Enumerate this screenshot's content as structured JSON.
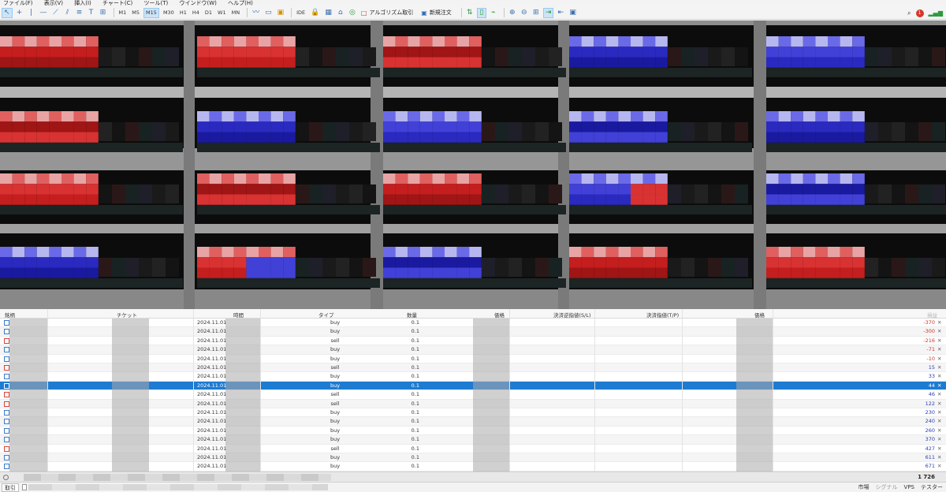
{
  "menu": {
    "items": [
      "ファイル(F)",
      "表示(V)",
      "挿入(I)",
      "チャート(C)",
      "ツール(T)",
      "ウインドウ(W)",
      "ヘルプ(H)"
    ]
  },
  "toolbar": {
    "tools": [
      "cursor-icon",
      "crosshair-icon",
      "vertical-line-icon",
      "horizontal-line-icon",
      "trendline-icon",
      "channel-icon",
      "fibonacci-icon",
      "text-icon",
      "shapes-icon"
    ],
    "timeframes": [
      "M1",
      "M5",
      "M15",
      "M30",
      "H1",
      "H4",
      "D1",
      "W1",
      "MN"
    ],
    "active_timeframe": "M15",
    "ide_label": "IDE",
    "algo_label": "アルゴリズム取引",
    "new_order_label": "新規注文",
    "notification_count": "1"
  },
  "table": {
    "headers": {
      "symbol": "銘柄",
      "ticket": "チケット",
      "time": "時間",
      "type": "タイプ",
      "volume": "数量",
      "price": "価格",
      "sl": "決済逆指値(S/L)",
      "tp": "決済指値(T/P)",
      "price2": "価格",
      "profit": "損益"
    },
    "rows": [
      {
        "time": "2024.11.01",
        "type": "buy",
        "volume": "0.1",
        "profit": "-370"
      },
      {
        "time": "2024.11.01",
        "type": "buy",
        "volume": "0.1",
        "profit": "-300"
      },
      {
        "time": "2024.11.01",
        "type": "sell",
        "volume": "0.1",
        "profit": "-216"
      },
      {
        "time": "2024.11.01",
        "type": "buy",
        "volume": "0.1",
        "profit": "-71"
      },
      {
        "time": "2024.11.01",
        "type": "buy",
        "volume": "0.1",
        "profit": "-10"
      },
      {
        "time": "2024.11.01",
        "type": "sell",
        "volume": "0.1",
        "profit": "15"
      },
      {
        "time": "2024.11.01",
        "type": "buy",
        "volume": "0.1",
        "profit": "33"
      },
      {
        "time": "2024.11.01",
        "type": "buy",
        "volume": "0.1",
        "profit": "44",
        "selected": true
      },
      {
        "time": "2024.11.01",
        "type": "sell",
        "volume": "0.1",
        "profit": "46"
      },
      {
        "time": "2024.11.01",
        "type": "sell",
        "volume": "0.1",
        "profit": "122"
      },
      {
        "time": "2024.11.01",
        "type": "buy",
        "volume": "0.1",
        "profit": "230"
      },
      {
        "time": "2024.11.01",
        "type": "buy",
        "volume": "0.1",
        "profit": "240"
      },
      {
        "time": "2024.11.01",
        "type": "buy",
        "volume": "0.1",
        "profit": "260"
      },
      {
        "time": "2024.11.01",
        "type": "buy",
        "volume": "0.1",
        "profit": "370"
      },
      {
        "time": "2024.11.01",
        "type": "sell",
        "volume": "0.1",
        "profit": "427"
      },
      {
        "time": "2024.11.01",
        "type": "buy",
        "volume": "0.1",
        "profit": "611"
      },
      {
        "time": "2024.11.01",
        "type": "buy",
        "volume": "0.1",
        "profit": "671"
      }
    ],
    "total_profit": "1 726"
  },
  "bottom": {
    "tab_label": "取引",
    "market_label": "市場",
    "signals_label": "シグナル",
    "vps_label": "VPS",
    "tester_label": "テスター"
  },
  "colors": {
    "selected_row": "#1e7bd2",
    "negative": "#d0342c",
    "positive": "#2a3fb3"
  }
}
